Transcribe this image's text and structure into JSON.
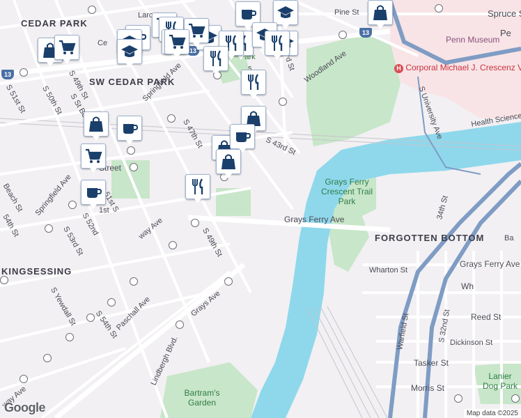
{
  "map": {
    "attribution": "Map data ©2025",
    "logo": "Google",
    "neighborhoods": [
      "CEDAR PARK",
      "SW CEDAR PARK",
      "KINGSESSING",
      "FORGOTTEN BOTTOM"
    ],
    "parks": [
      "Grays Ferry Crescent Trail Park",
      "Bartram's Garden",
      "Lanier Dog Park"
    ],
    "landmarks": {
      "penn_museum": "Penn Museum",
      "va_medical": "Corporal Michael J. Crescenz VA Medical Ctr",
      "hospital_icon": "hospital-icon"
    },
    "route_shields": [
      "13",
      "13",
      "13"
    ],
    "streets": {
      "pine": "Pine St",
      "spruce": "Spruce St",
      "larc": "Larc",
      "woodland": "Woodland Ave",
      "s43rd": "S 43rd St",
      "s47th": "S 47th St",
      "s49th": "S 49th St",
      "s50th": "S 50th St",
      "s49th_a": "S 49th St",
      "s51st": "S 51st St",
      "s52nd": "S 52nd",
      "s53rd": "S 53rd St",
      "s54th": "S 54th St",
      "s_st_bern": "S St Bern",
      "springfield_ave": "Springfield Ave",
      "springfield_ave2": "Springfield Ave",
      "beach": "Beach St",
      "s54th_a": "54th St",
      "s_yewdall": "S Yewdall St",
      "paschall": "Paschall Ave",
      "grays_ferry": "Grays Ferry Ave",
      "grays_ferry2": "Grays Ferry Ave",
      "grays_ave": "Grays Ave",
      "lindbergh": "Lindbergh Blvd.",
      "wharton": "Wharton St",
      "reed": "Reed St",
      "dickinson": "Dickinson St",
      "tasker": "Tasker St",
      "morris": "Morris St",
      "warfield": "Warfield St",
      "s32nd": "S 32nd St",
      "s34th": "34th St",
      "s_university": "S University Ave",
      "health_sciences": "Health Sciences",
      "street_station": "Street",
      "s51st_b": "51st S",
      "way_ave": "way Ave",
      "ec_frag": "Ce",
      "way2": "way Ave",
      "s2nd": "2nd St",
      "pe": "Pe",
      "park_frag": "Park",
      "s_frag": "s",
      "wh": "Wh",
      "ba": "Ba",
      "bp_frag": "1st",
      "pine_bubble": "Pine St"
    },
    "pins": [
      {
        "icon": "coffee-cup-icon"
      },
      {
        "icon": "graduation-cap-icon"
      },
      {
        "icon": "shopping-bag-icon"
      },
      {
        "icon": "shopping-cart-icon"
      },
      {
        "icon": "fork-knife-icon"
      },
      {
        "icon": "coffee-cup-icon"
      },
      {
        "icon": "graduation-cap-icon"
      },
      {
        "icon": "shopping-cart-icon"
      },
      {
        "icon": "fork-knife-icon"
      },
      {
        "icon": "shopping-bag-icon"
      },
      {
        "icon": "fork-knife-icon"
      },
      {
        "icon": "shopping-cart-icon"
      },
      {
        "icon": "graduation-cap-icon"
      },
      {
        "icon": "fork-knife-icon"
      },
      {
        "icon": "shopping-cart-icon"
      },
      {
        "icon": "graduation-cap-icon"
      },
      {
        "icon": "graduation-cap-icon"
      },
      {
        "icon": "fork-knife-icon"
      },
      {
        "icon": "graduation-cap-icon"
      },
      {
        "icon": "shopping-cart-icon"
      },
      {
        "icon": "fork-knife-icon"
      },
      {
        "icon": "shopping-bag-icon"
      },
      {
        "icon": "shopping-bag-icon"
      },
      {
        "icon": "coffee-cup-icon"
      },
      {
        "icon": "shopping-bag-icon"
      },
      {
        "icon": "shopping-bag-icon"
      },
      {
        "icon": "coffee-cup-icon"
      },
      {
        "icon": "shopping-cart-icon"
      },
      {
        "icon": "coffee-cup-icon"
      },
      {
        "icon": "fork-knife-icon"
      }
    ],
    "colors": {
      "water": "#8fd8ec",
      "park": "#c8e6c9",
      "pin_icon": "#1a3f6b",
      "highway": "#7f9cc4"
    }
  }
}
